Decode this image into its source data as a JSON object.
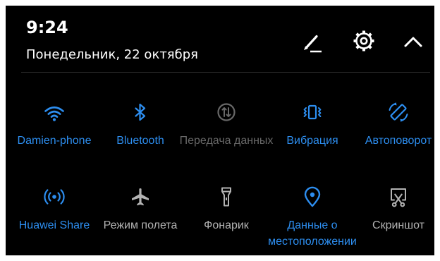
{
  "status": {
    "time": "9:24",
    "date": "Понедельник, 22 октября"
  },
  "header_icons": [
    "edit-icon",
    "settings-gear-icon",
    "collapse-chevron-icon"
  ],
  "colors": {
    "background": "#000000",
    "active": "#2d8ef0",
    "inactive": "#b3b3b3",
    "disabled": "#686868"
  },
  "toggles": [
    {
      "label": "Damien-phone",
      "icon": "wifi-icon",
      "state": "on"
    },
    {
      "label": "Bluetooth",
      "icon": "bluetooth-icon",
      "state": "on"
    },
    {
      "label": "Передача данных",
      "icon": "mobile-data-icon",
      "state": "disabled"
    },
    {
      "label": "Вибрация",
      "icon": "vibrate-icon",
      "state": "on"
    },
    {
      "label": "Автоповорот",
      "icon": "auto-rotate-icon",
      "state": "on"
    },
    {
      "label": "Huawei Share",
      "icon": "huawei-share-icon",
      "state": "on"
    },
    {
      "label": "Режим полета",
      "icon": "airplane-icon",
      "state": "off"
    },
    {
      "label": "Фонарик",
      "icon": "flashlight-icon",
      "state": "off"
    },
    {
      "label": "Данные о местоположении",
      "icon": "location-icon",
      "state": "on"
    },
    {
      "label": "Скриншот",
      "icon": "screenshot-icon",
      "state": "off"
    }
  ]
}
